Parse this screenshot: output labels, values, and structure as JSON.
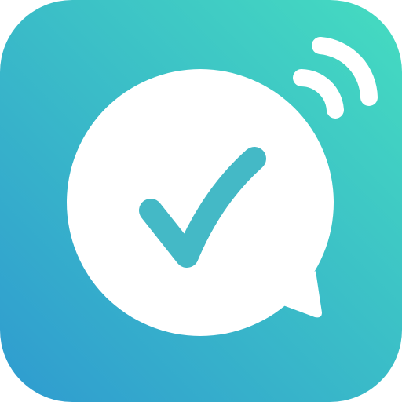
{
  "app_icon": {
    "name": "chat-check-signal-app-icon",
    "colors": {
      "gradient_start": "#2f9bd0",
      "gradient_end": "#45dcc0",
      "bubble": "#ffffff",
      "check": "#44b9c6",
      "signal": "#ffffff"
    },
    "icons": {
      "bubble": "speech-bubble-icon",
      "check": "checkmark-icon",
      "signal": "wireless-signal-icon"
    }
  }
}
